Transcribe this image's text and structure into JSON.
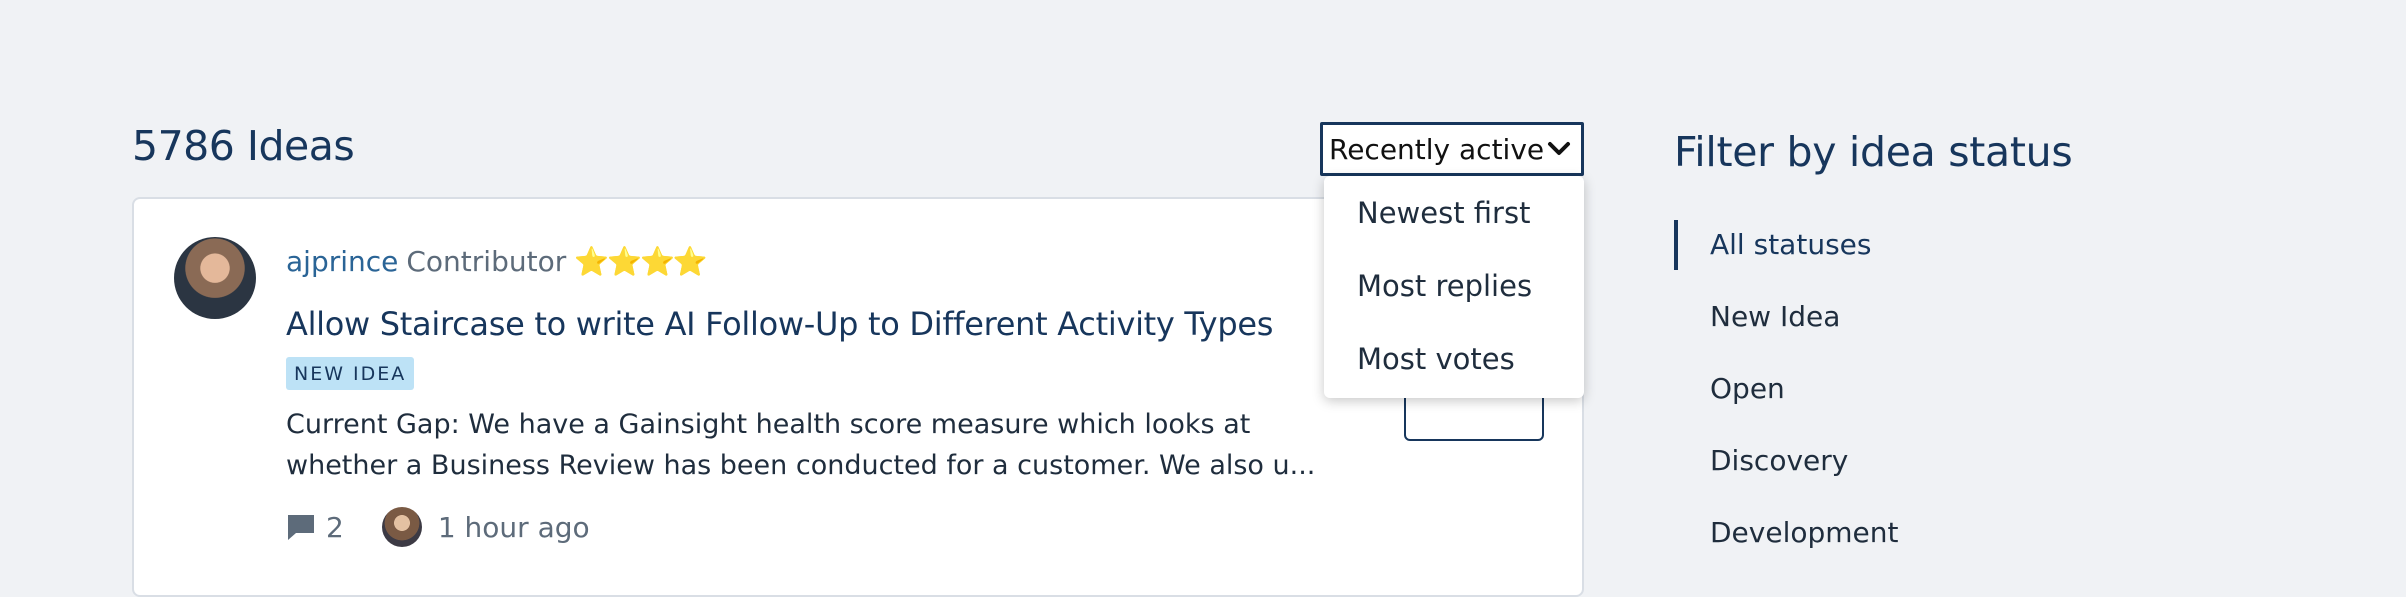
{
  "ideas": {
    "count_label": "5786 Ideas"
  },
  "sort": {
    "selected": "Recently active",
    "options": [
      "Newest first",
      "Most replies",
      "Most votes"
    ]
  },
  "idea_card": {
    "author": "ajprince",
    "role": "Contributor",
    "stars": "⭐⭐⭐⭐",
    "title": "Allow Staircase to write AI Follow-Up to Different Activity Types",
    "badge": "NEW IDEA",
    "description_line1": "Current Gap: We have a Gainsight health score measure which looks at",
    "description_line2": "whether a Business Review has been conducted for a customer. We also u...",
    "reply_count": "2",
    "last_activity": "1 hour ago"
  },
  "sidebar": {
    "title": "Filter by idea status",
    "statuses": [
      {
        "label": "All statuses",
        "active": true
      },
      {
        "label": "New Idea",
        "active": false
      },
      {
        "label": "Open",
        "active": false
      },
      {
        "label": "Discovery",
        "active": false
      },
      {
        "label": "Development",
        "active": false
      }
    ]
  },
  "colors": {
    "background": "#f0f2f5",
    "primary": "#17365c",
    "link": "#2a6496",
    "badge_bg": "#bde2f6"
  }
}
